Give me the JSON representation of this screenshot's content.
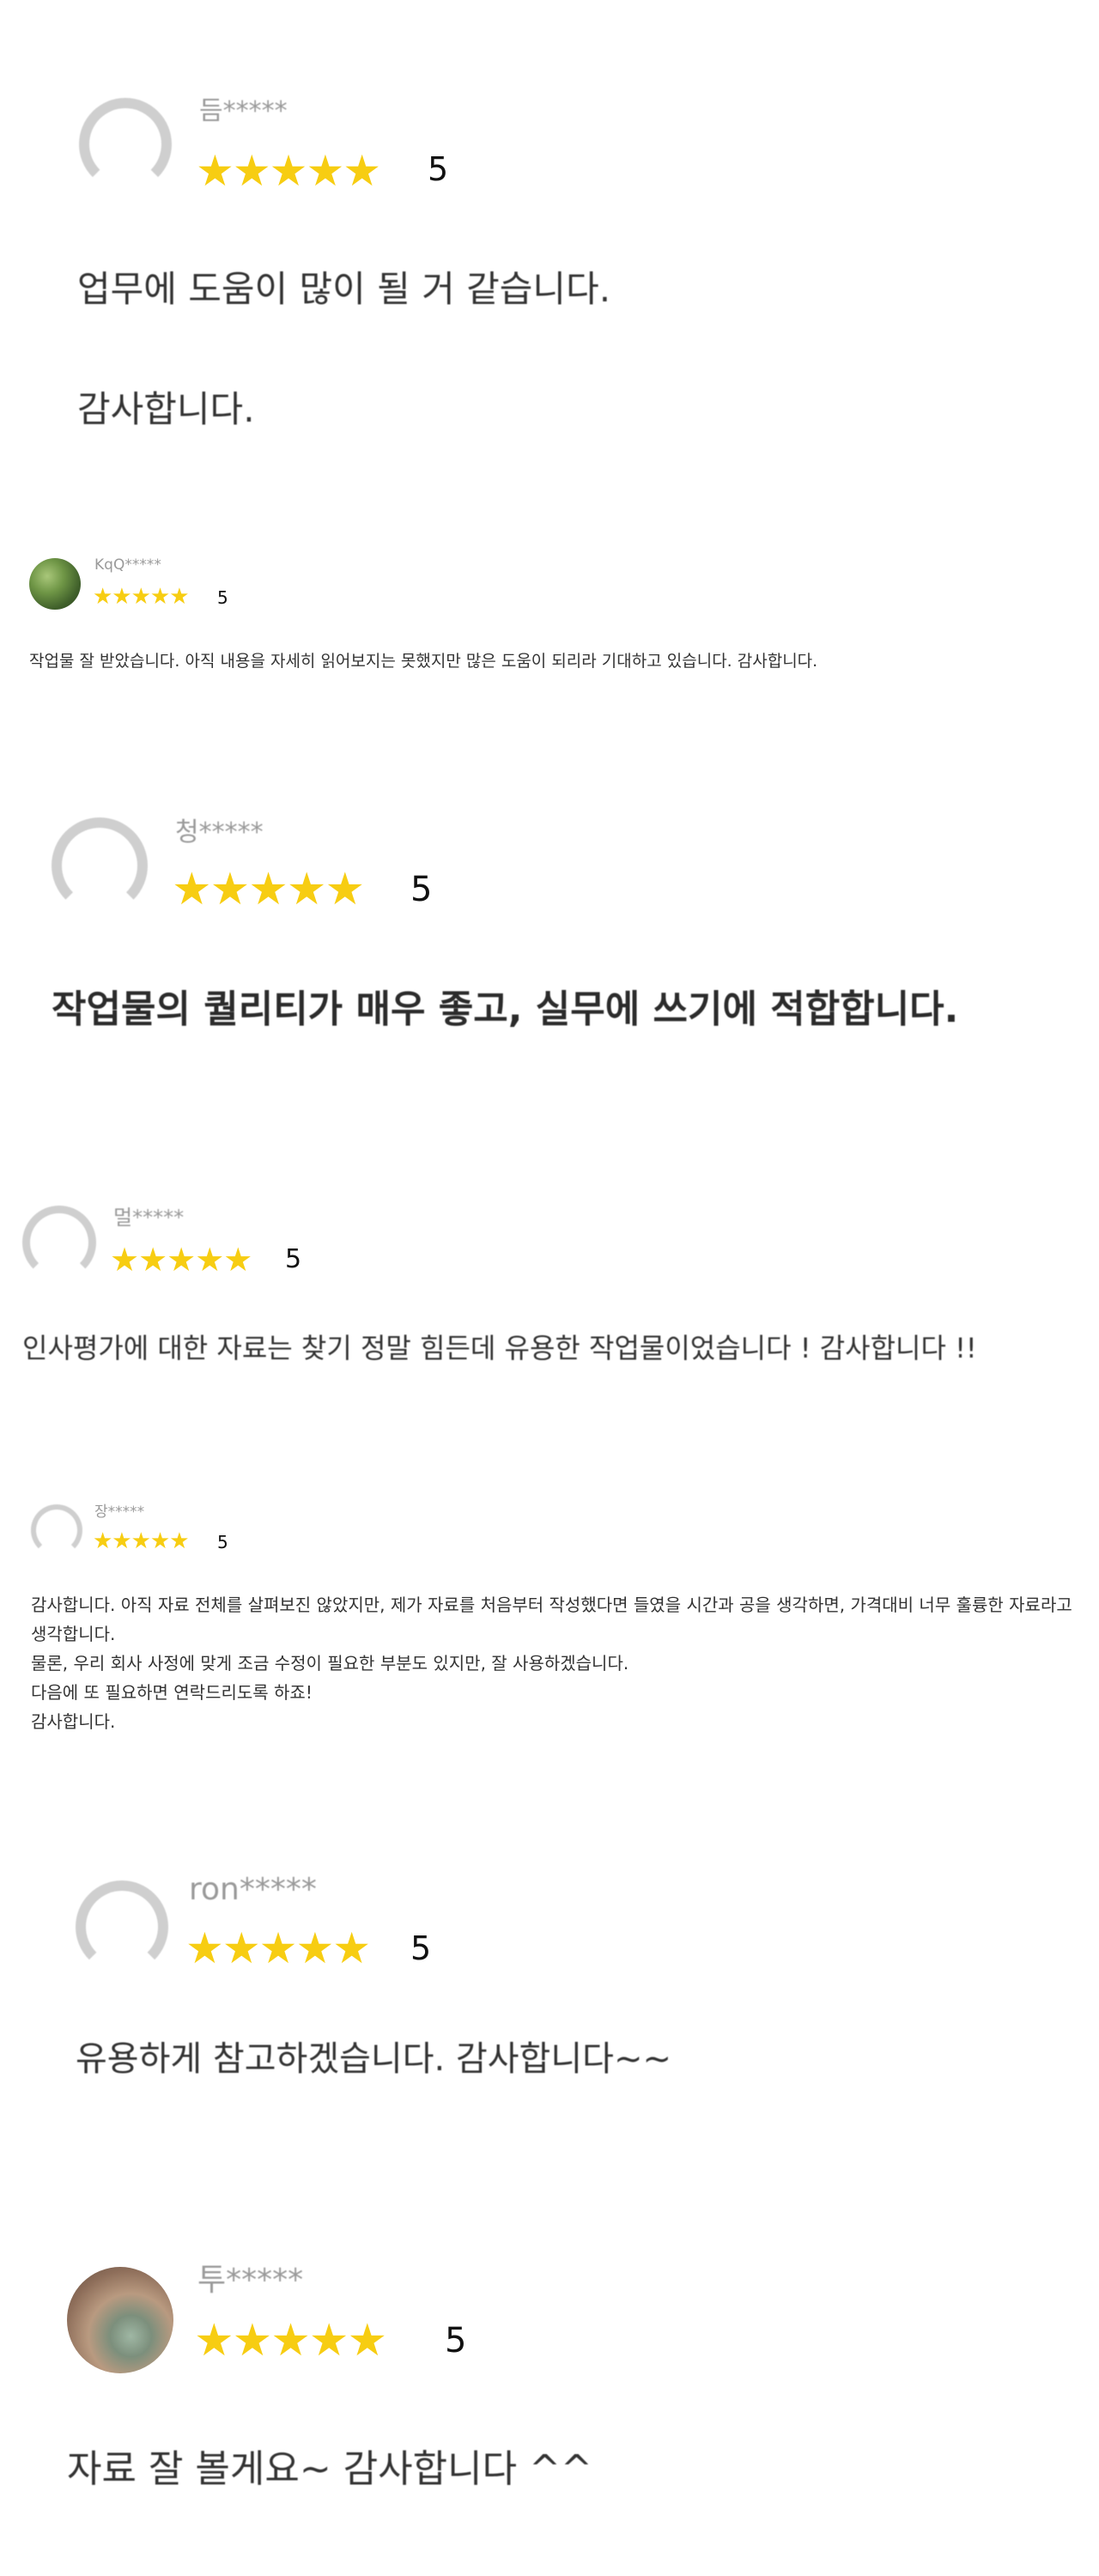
{
  "reviews": [
    {
      "username": "듬*****",
      "rating_stars": "★★★★★",
      "rating": "5",
      "rating_value": 5,
      "text": "업무에 도움이 많이 될 거 같습니다.\n\n감사합니다."
    },
    {
      "username": "KqQ*****",
      "rating_stars": "★★★★★",
      "rating": "5",
      "rating_value": 5,
      "text": "작업물 잘 받았습니다. 아직 내용을 자세히 읽어보지는 못했지만 많은 도움이 되리라 기대하고 있습니다. 감사합니다."
    },
    {
      "username": "청*****",
      "rating_stars": "★★★★★",
      "rating": "5",
      "rating_value": 5,
      "text": "작업물의 퀄리티가 매우 좋고, 실무에 쓰기에 적합합니다."
    },
    {
      "username": "멀*****",
      "rating_stars": "★★★★★",
      "rating": "5",
      "rating_value": 5,
      "text": "인사평가에 대한 자료는 찾기 정말 힘든데 유용한 작업물이었습니다 ! 감사합니다 !!"
    },
    {
      "username": "장*****",
      "rating_stars": "★★★★★",
      "rating": "5",
      "rating_value": 5,
      "text": "감사합니다. 아직 자료 전체를 살펴보진 않았지만, 제가 자료를 처음부터 작성했다면 들였을 시간과 공을 생각하면, 가격대비 너무 훌륭한 자료라고 생각합니다.\n물론, 우리 회사 사정에 맞게 조금 수정이 필요한 부분도 있지만, 잘 사용하겠습니다.\n다음에 또 필요하면 연락드리도록 하죠!\n감사합니다."
    },
    {
      "username": "ron*****",
      "rating_stars": "★★★★★",
      "rating": "5",
      "rating_value": 5,
      "text": "유용하게 참고하겠습니다. 감사합니다~~"
    },
    {
      "username": "투*****",
      "rating_stars": "★★★★★",
      "rating": "5",
      "rating_value": 5,
      "text": "자료 잘 볼게요~ 감사합니다 ^^"
    }
  ],
  "colors": {
    "star": "#f7cd12",
    "username": "#9a9a9a",
    "text": "#333333",
    "avatar_placeholder": "#cfcfcf"
  }
}
